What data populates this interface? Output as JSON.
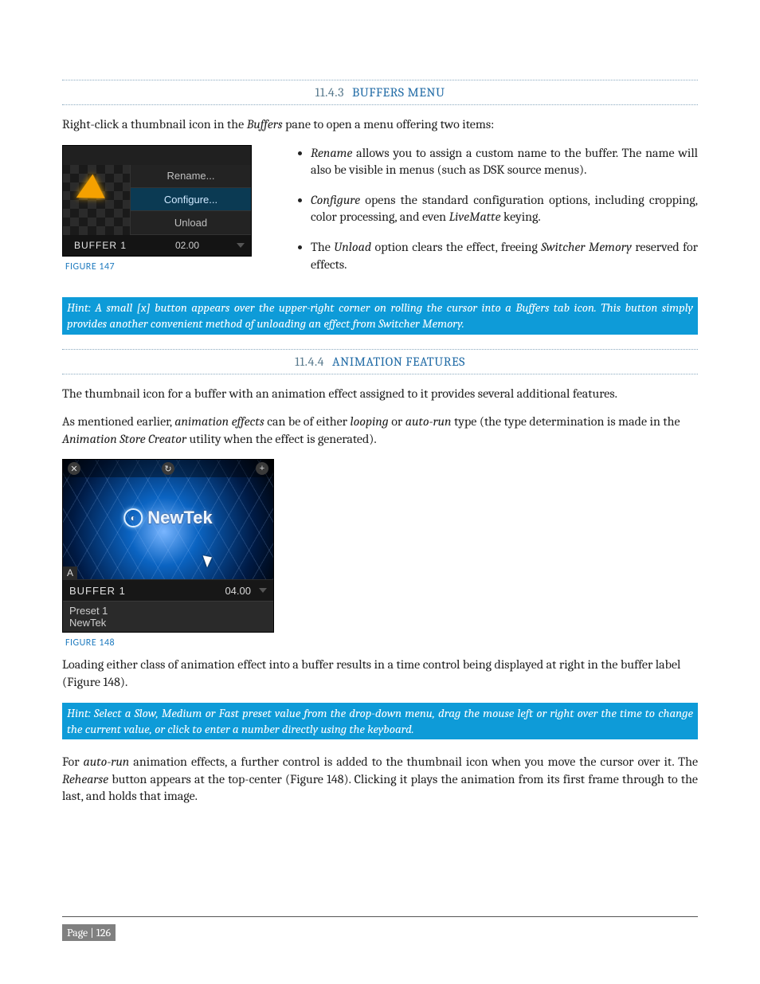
{
  "sections": {
    "buffers_menu": {
      "num": "11.4.3",
      "title": "BUFFERS MENU"
    },
    "animation": {
      "num": "11.4.4",
      "title": "ANIMATION FEATURES"
    }
  },
  "intro_buffers": {
    "pre": "Right-click a thumbnail icon in the ",
    "em": "Buffers",
    "post": " pane to open a menu offering two items:"
  },
  "fig147": {
    "caption": "FIGURE 147",
    "menu": {
      "rename": "Rename...",
      "configure": "Configure...",
      "unload": "Unload"
    },
    "label": "BUFFER 1",
    "time": "02.00"
  },
  "bullets": {
    "b1": {
      "em": "Rename",
      "text": " allows you to assign a custom name to the buffer.  The name will also be visible in menus (such as DSK source menus)."
    },
    "b2": {
      "em1": "Configure",
      "mid": " opens the standard configuration options, including cropping, color processing, and even ",
      "em2": "LiveMatte",
      "post": " keying."
    },
    "b3": {
      "pre": "The ",
      "em1": "Unload",
      "mid": " option clears the effect, freeing ",
      "em2": "Switcher Memory",
      "post": " reserved for effects."
    }
  },
  "hint1": "Hint: A small [x] button appears over the upper-right corner on rolling the cursor into a Buffers tab icon.  This button simply provides another convenient method of unloading an effect from Switcher Memory.",
  "anim": {
    "p1": "The thumbnail icon for a buffer with an animation effect assigned to it provides several additional features.",
    "p2": {
      "pre": "As mentioned earlier, ",
      "em1": "animation effects",
      "mid1": " can be of either ",
      "em2": "looping",
      "mid2": " or ",
      "em3": "auto-run",
      "mid3": " type (the type determination is made in the ",
      "em4": "Animation Store Creator",
      "post": " utility when the effect is generated)."
    }
  },
  "fig148": {
    "caption": "FIGURE 148",
    "brand": "NewTek",
    "a": "A",
    "label": "BUFFER 1",
    "time": "04.00",
    "preset1": "Preset 1",
    "preset2": "NewTek",
    "icons": {
      "x": "✕",
      "loop": "↻",
      "plus": "+"
    }
  },
  "after148": "Loading either class of animation effect into a buffer results in a time control being displayed at right in the buffer label (Figure 148).",
  "hint2": "Hint: Select a Slow, Medium or Fast preset value from the drop-down menu, drag the mouse left or right over the time to change the current value, or click to enter a number directly using the keyboard.",
  "autorun": {
    "pre": "For ",
    "em1": "auto-run",
    "mid1": " animation effects, a further control is added to the thumbnail icon when you move the cursor over it.  The ",
    "em2": "Rehearse",
    "post": " button appears at the top-center (Figure 148).  Clicking it plays the animation from its first frame through to the last, and holds that image."
  },
  "footer": "Page | 126"
}
